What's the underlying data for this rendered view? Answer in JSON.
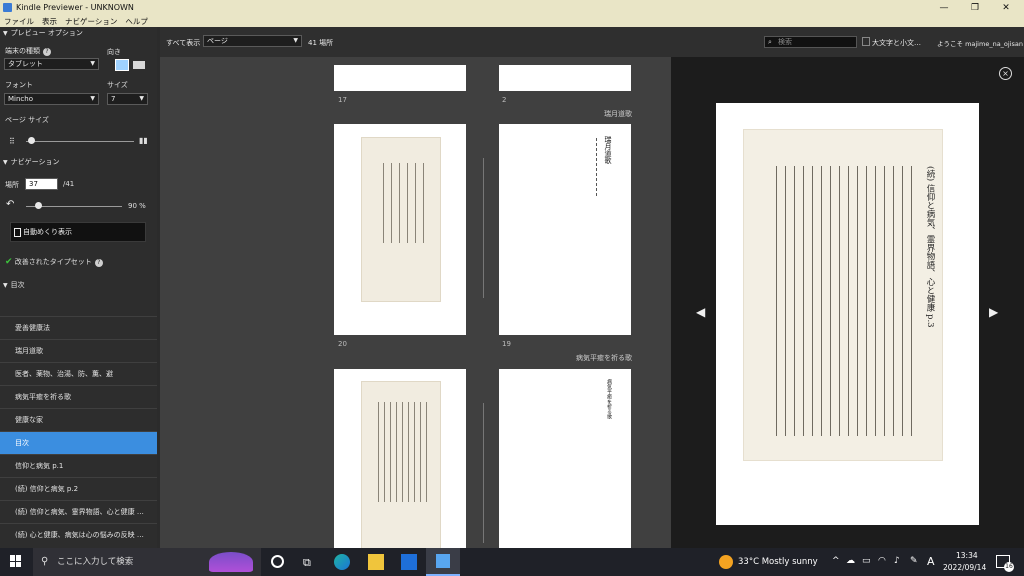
{
  "window": {
    "title": "Kindle Previewer - UNKNOWN",
    "minimize": "—",
    "maximize": "❐",
    "close": "✕"
  },
  "menu": [
    "ファイル",
    "表示",
    "ナビゲーション",
    "ヘルプ"
  ],
  "left": {
    "preview_options": "プレビュー オプション",
    "device_type_label": "端末の種類",
    "orientation_label": "向き",
    "device_value": "タブレット",
    "font_label": "フォント",
    "size_label": "サイズ",
    "font_value": "Mincho",
    "size_value": "7",
    "page_size_label": "ページ サイズ",
    "navigation": "ナビゲーション",
    "location_label": "場所",
    "location_value": "37",
    "location_total": "/41",
    "progress_label": "90 %",
    "progress_value": 0.2,
    "auto_advance": "自動めくり表示",
    "typeset": "改善されたタイプセット",
    "toc_header": "目次",
    "toc_items": [
      "愛善健康法",
      "瑞月道歌",
      "医者、薬物、治湯、防、薫、避",
      "病気平癒を祈る歌",
      "健康な家",
      "目次",
      "信仰と病気 p.1",
      "(続) 信仰と病気 p.2",
      "(続) 信仰と病気、霊界物語、心と健康 …",
      "(続) 心と健康、病気は心の悩みの反映 …"
    ]
  },
  "toolbar": {
    "view_all": "すべて表示",
    "mode": "ページ",
    "locations": "41 場所",
    "search_placeholder": "検索",
    "case_toggle": "大文字と小文…",
    "welcome": "ようこそ majime_na_ojisan"
  },
  "grid": {
    "row1": {
      "left_num": "17",
      "right_num": "2"
    },
    "row2": {
      "chapter": "瑞月道歌",
      "left_num": "20",
      "right_num": "19",
      "title_text": "瑞月道歌"
    },
    "row3": {
      "chapter": "病気平癒を祈る歌",
      "right_title": "病気平癒を祈る歌"
    }
  },
  "preview": {
    "heading": "(続) 信仰と病気、霊界物語、心と健康 p.3",
    "close": "×",
    "prev": "◀",
    "next": "▶"
  },
  "taskbar": {
    "search_placeholder": "ここに入力して検索",
    "weather": "33°C Mostly sunny",
    "time": "13:34",
    "date": "2022/09/14",
    "ime": "A",
    "notifications": "16"
  }
}
